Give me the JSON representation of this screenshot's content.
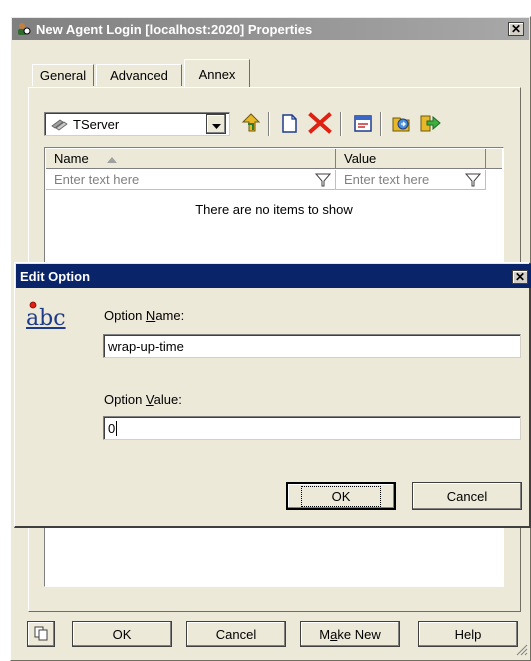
{
  "properties_window": {
    "title": "New Agent Login [localhost:2020] Properties",
    "close_glyph": "✕",
    "tabs": [
      {
        "label": "General"
      },
      {
        "label": "Advanced"
      },
      {
        "label": "Annex"
      }
    ],
    "section_select": {
      "value": "TServer"
    },
    "grid": {
      "columns": [
        {
          "label": "Name"
        },
        {
          "label": "Value"
        }
      ],
      "filter_placeholder": "Enter text here",
      "empty_message": "There are no items to show"
    },
    "buttons": {
      "ok": "OK",
      "cancel": "Cancel",
      "make_new_prefix": "M",
      "make_new_accel": "a",
      "make_new_suffix": "ke New",
      "help": "Help"
    }
  },
  "edit_dialog": {
    "title": "Edit Option",
    "close_glyph": "✕",
    "icon_text": "abc",
    "option_name_label_prefix": "Option ",
    "option_name_label_accel": "N",
    "option_name_label_suffix": "ame:",
    "option_name_value": "wrap-up-time",
    "option_value_label_prefix": "Option ",
    "option_value_label_accel": "V",
    "option_value_label_suffix": "alue:",
    "option_value_value": "0",
    "ok_label": "OK",
    "cancel_label": "Cancel"
  },
  "colors": {
    "dialog_bg": "#ECE9D8",
    "active_title": "#0A246A",
    "delete_red": "#E02010"
  }
}
